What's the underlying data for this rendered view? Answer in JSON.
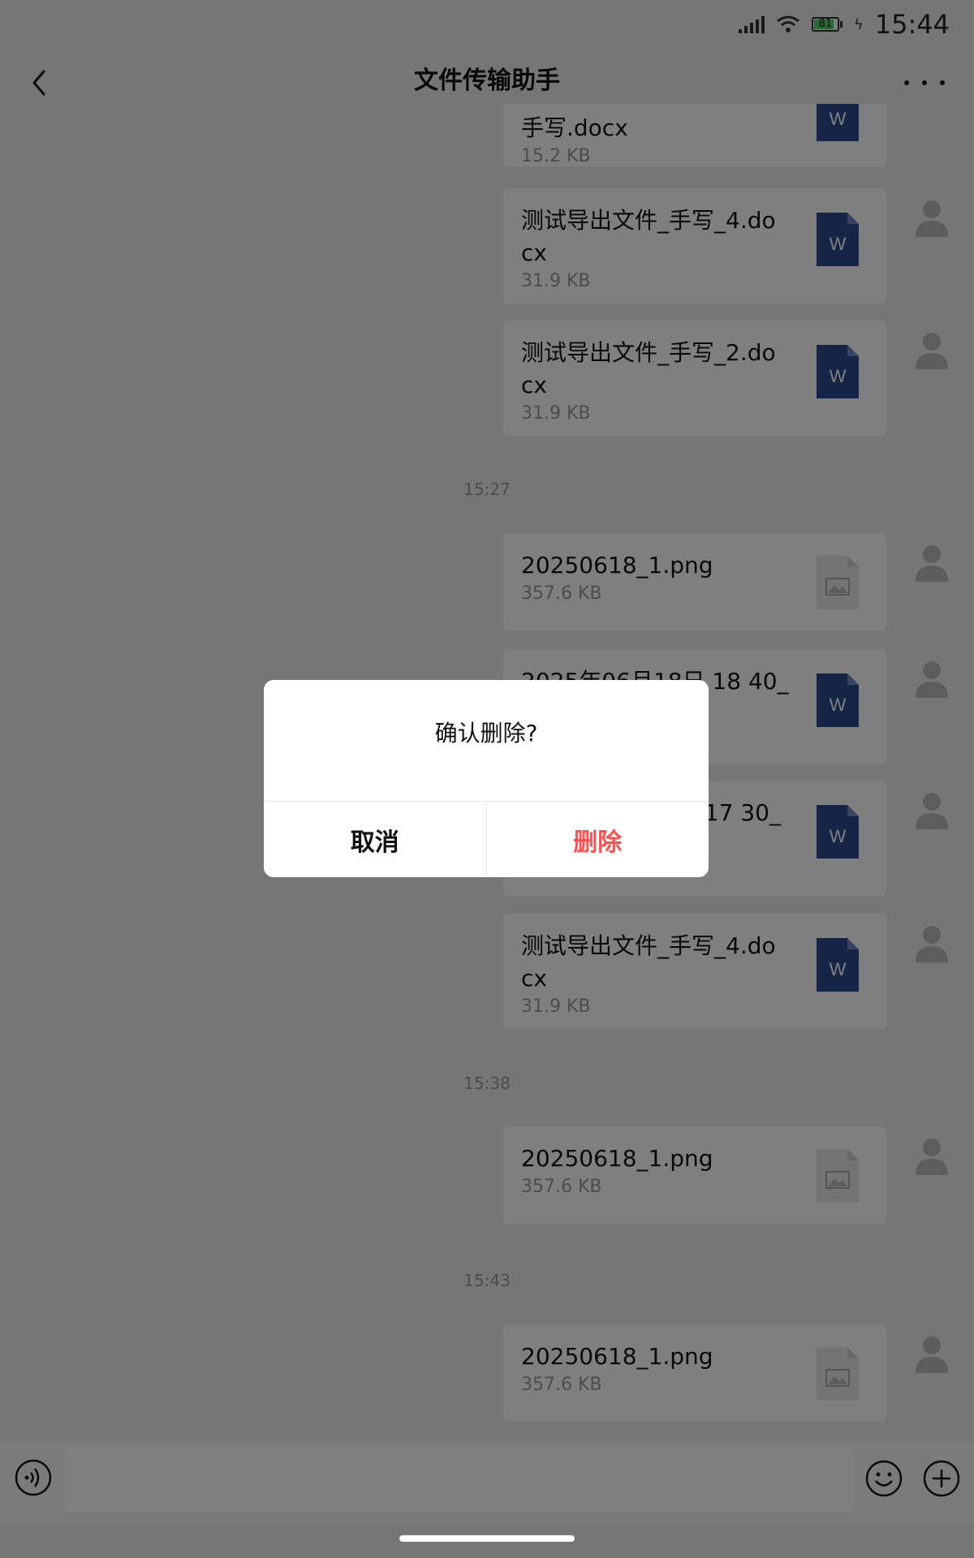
{
  "status_bar": {
    "battery": "81",
    "time": "15:44"
  },
  "header": {
    "title": "文件传输助手"
  },
  "messages": [
    {
      "name": "手写.docx",
      "size": "15.2 KB",
      "icon": "word-file-icon"
    },
    {
      "name": "测试导出文件_手写_4.docx",
      "size": "31.9 KB",
      "icon": "word-file-icon"
    },
    {
      "name": "测试导出文件_手写_2.docx",
      "size": "31.9 KB",
      "icon": "word-file-icon"
    },
    {
      "name": "20250618_1.png",
      "size": "357.6 KB",
      "icon": "image-file-icon"
    },
    {
      "name": "2025年06月18日 18 40_",
      "size": "",
      "icon": "word-file-icon"
    },
    {
      "name": "17 30_",
      "size": "",
      "icon": "word-file-icon"
    },
    {
      "name": "测试导出文件_手写_4.docx",
      "size": "31.9 KB",
      "icon": "word-file-icon"
    },
    {
      "name": "20250618_1.png",
      "size": "357.6 KB",
      "icon": "image-file-icon"
    },
    {
      "name": "20250618_1.png",
      "size": "357.6 KB",
      "icon": "image-file-icon"
    }
  ],
  "timestamps": [
    "15:27",
    "15:38",
    "15:43"
  ],
  "dialog": {
    "message": "确认删除?",
    "cancel_label": "取消",
    "delete_label": "删除"
  },
  "colors": {
    "accent_delete": "#fa5151",
    "word_icon": "#2b4a8a",
    "battery_fill": "#4cd964"
  }
}
